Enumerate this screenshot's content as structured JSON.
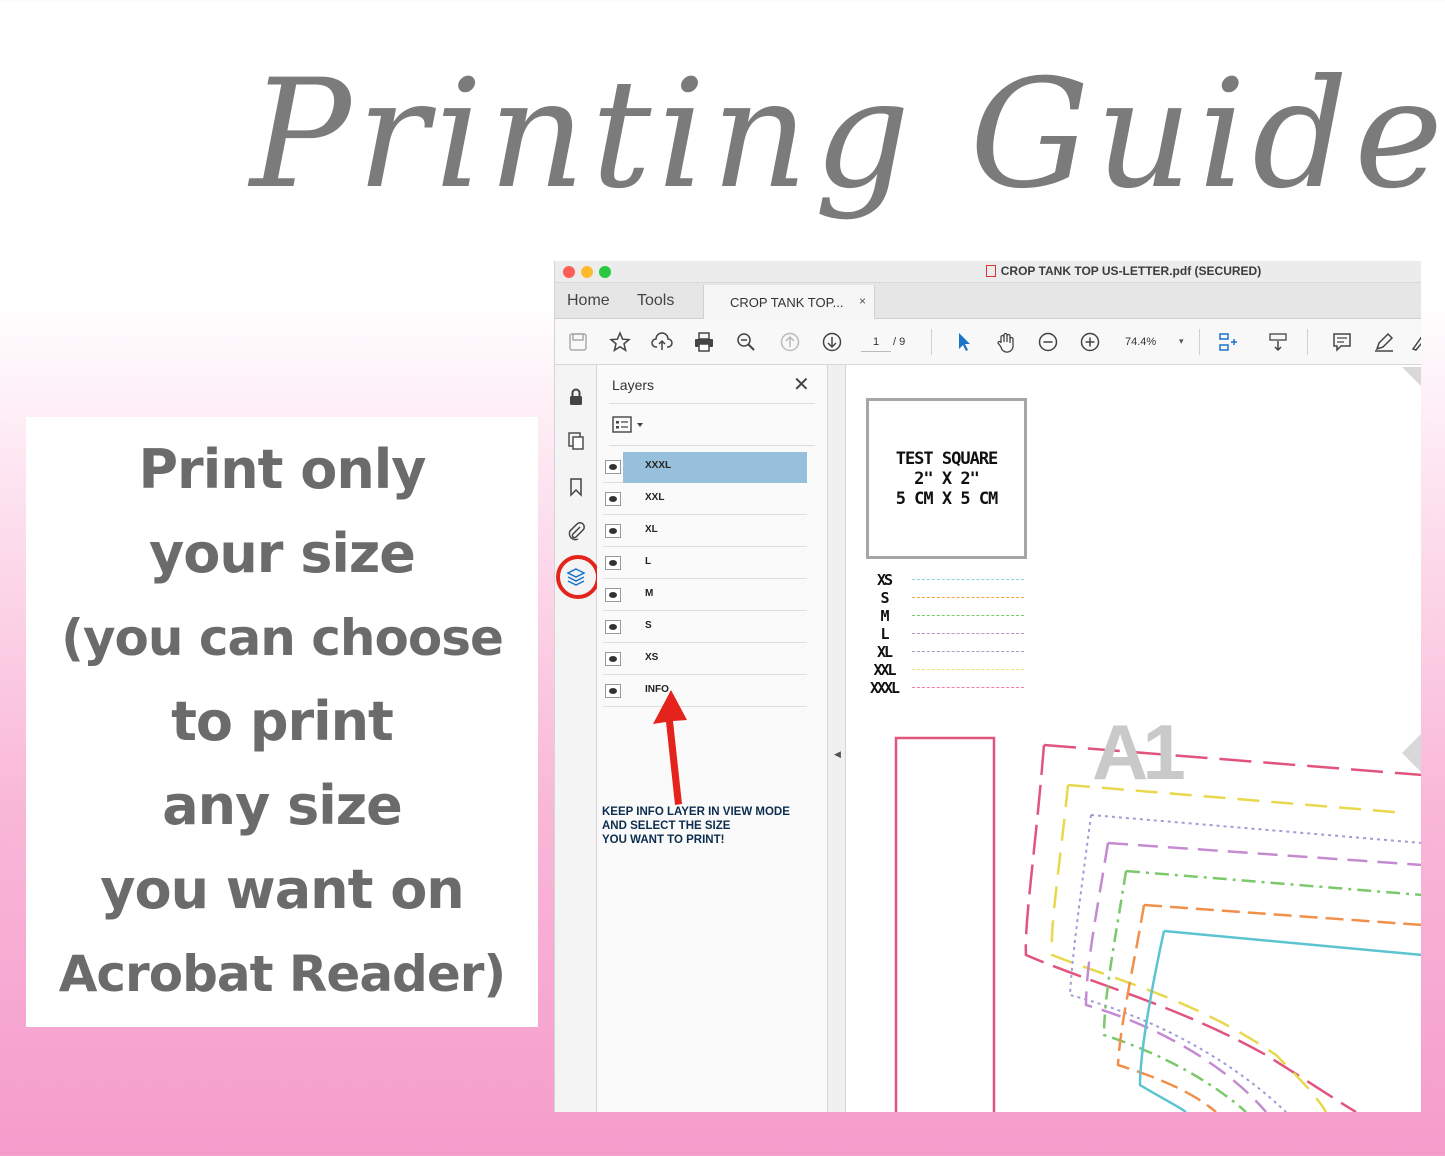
{
  "headline": "Printing Guide",
  "tip_lines": [
    "Print only",
    "your size",
    "(you can choose",
    "to print",
    "any size",
    "you want on",
    "Acrobat Reader)"
  ],
  "window": {
    "title": "CROP TANK TOP US-LETTER.pdf (SECURED)",
    "nav": {
      "home": "Home",
      "tools": "Tools"
    },
    "doc_tab": {
      "label": "CROP TANK TOP...",
      "close": "×"
    }
  },
  "toolbar": {
    "page_current": "1",
    "page_total": "/ 9",
    "zoom": "74.4%",
    "zoom_dropdown": "▾"
  },
  "layers_panel": {
    "title": "Layers",
    "close": "✕",
    "items": [
      {
        "name": "XXXL",
        "selected": true
      },
      {
        "name": "XXL",
        "selected": false
      },
      {
        "name": "XL",
        "selected": false
      },
      {
        "name": "L",
        "selected": false
      },
      {
        "name": "M",
        "selected": false
      },
      {
        "name": "S",
        "selected": false
      },
      {
        "name": "XS",
        "selected": false
      },
      {
        "name": "INFO",
        "selected": false
      }
    ],
    "note": [
      "KEEP INFO LAYER IN VIEW MODE",
      "AND SELECT THE SIZE",
      "YOU WANT TO PRINT!"
    ]
  },
  "document": {
    "test_square": [
      "TEST SQUARE",
      "2\" X 2\"",
      "5 CM X 5 CM"
    ],
    "size_legend": [
      {
        "label": "XS",
        "color": "#8fd3e0"
      },
      {
        "label": "S",
        "color": "#f0a24a"
      },
      {
        "label": "M",
        "color": "#7bc96a"
      },
      {
        "label": "L",
        "color": "#c58bd1"
      },
      {
        "label": "XL",
        "color": "#9e9ed6"
      },
      {
        "label": "XXL",
        "color": "#f0e07a"
      },
      {
        "label": "XXXL",
        "color": "#f27f9c"
      }
    ],
    "piece_label": "A1"
  },
  "colors": {
    "accent_ring": "#e4231c",
    "arrow": "#e4231c",
    "selected_layer": "#97c0dd",
    "headline": "#7b7b7b",
    "tip_text": "#6b6b6b"
  }
}
